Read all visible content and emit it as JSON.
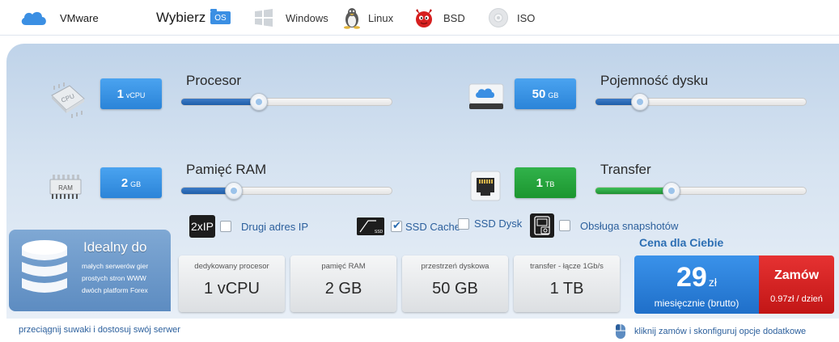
{
  "topbar": {
    "vmware_label": "VMware",
    "choose_label": "Wybierz",
    "os_badge": "OS",
    "os_options": [
      {
        "label": "Windows",
        "icon": "windows-icon"
      },
      {
        "label": "Linux",
        "icon": "tux-icon"
      },
      {
        "label": "BSD",
        "icon": "bsd-daemon-icon"
      },
      {
        "label": "ISO",
        "icon": "disc-icon"
      }
    ]
  },
  "sliders": {
    "cpu": {
      "label": "Procesor",
      "value": "1",
      "unit": "vCPU",
      "level": 0.37,
      "color": "#3b8fe3"
    },
    "disk": {
      "label": "Pojemność dysku",
      "value": "50",
      "unit": "GB",
      "level": 0.21,
      "color": "#3b8fe3"
    },
    "ram": {
      "label": "Pamięć RAM",
      "value": "2",
      "unit": "GB",
      "level": 0.25,
      "color": "#3b8fe3"
    },
    "transfer": {
      "label": "Transfer",
      "value": "1",
      "unit": "TB",
      "level": 0.36,
      "color": "#1f9a34"
    }
  },
  "options": {
    "ip": {
      "tag": "2xIP",
      "label": "Drugi adres IP",
      "checked": false
    },
    "ssd_cache": {
      "label": "SSD Cache",
      "checked": true,
      "tag": "SSD"
    },
    "ssd_disk": {
      "label": "SSD Dysk",
      "checked": false
    },
    "snapshots": {
      "label": "Obsługa snapshotów",
      "checked": false
    }
  },
  "ideal": {
    "title": "Idealny do",
    "lines": [
      "małych serwerów gier",
      "prostych stron WWW",
      "dwóch platform Forex"
    ]
  },
  "specs": [
    {
      "label": "dedykowany procesor",
      "value": "1 vCPU"
    },
    {
      "label": "pamięć RAM",
      "value": "2 GB"
    },
    {
      "label": "przestrzeń dyskowa",
      "value": "50 GB"
    },
    {
      "label": "transfer - łącze 1Gb/s",
      "value": "1 TB"
    }
  ],
  "price": {
    "label": "Cena dla Ciebie",
    "amount": "29",
    "currency": "zł",
    "period": "miesięcznie (brutto)"
  },
  "order": {
    "label": "Zamów",
    "daily": "0.97zł / dzień"
  },
  "footer": {
    "left": "przeciągnij suwaki i dostosuj swój serwer",
    "right": "kliknij zamów i skonfiguruj opcje dodatkowe"
  },
  "colors": {
    "accent_blue": "#3b8fe3",
    "accent_green": "#1f9a34",
    "order_red": "#d42020",
    "link_blue": "#2b5f9c"
  }
}
